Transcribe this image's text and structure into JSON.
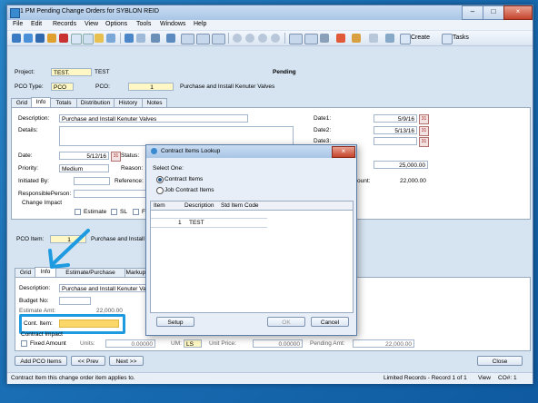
{
  "window": {
    "title": "1 PM Pending Change Orders for SYBLON REID",
    "min": "–",
    "max": "□",
    "close": "×"
  },
  "menu": [
    "File",
    "Edit",
    "Records",
    "View",
    "Options",
    "Tools",
    "Windows",
    "Help"
  ],
  "toolbar": {
    "create_label": "Create",
    "tasks_label": "Tasks"
  },
  "header": {
    "project_label": "Project:",
    "project_value": "TEST.",
    "project_name": "TEST",
    "status": "Pending",
    "pco_type_label": "PCO Type:",
    "pco_type_value": "PCO",
    "pco_label": "PCO:",
    "pco_value": "1",
    "pco_desc": "Purchase and Install Kenuter Valves"
  },
  "top_tabs": [
    "Grid",
    "Info",
    "Totals",
    "Distribution",
    "History",
    "Notes"
  ],
  "info": {
    "description_label": "Description:",
    "description_value": "Purchase and Install Kenuter Valves",
    "details_label": "Details:",
    "date_label": "Date:",
    "date_value": "5/12/16",
    "status_label": "Status:",
    "priority_label": "Priority:",
    "priority_value": "Medium",
    "reason_label": "Reason:",
    "initiated_label": "Initiated By:",
    "reference_label": "Reference:",
    "responsible_label": "ResponsiblePerson:",
    "change_impact_label": "Change Impact",
    "estimate_label": "Estimate",
    "sl_label": "SL",
    "fl_label": "F",
    "date1_label": "Date1:",
    "date1_value": "5/9/16",
    "date2_label": "Date2:",
    "date2_value": "5/13/16",
    "date3_label": "Date3:",
    "amount_value": "25,000.00",
    "ount_label": "ount:",
    "amount2_value": "22,000.00"
  },
  "item": {
    "label": "PCO Item:",
    "value": "1",
    "desc": "Purchase and Install K"
  },
  "bottom_tabs": [
    "Grid",
    "Info",
    "Estimate/Purchase Details",
    "Markups"
  ],
  "item_info": {
    "description_label": "Description:",
    "description_value": "Purchase and Install Kenuter Valves",
    "budget_label": "Budget No:",
    "estimate_label": "Estimate Amt:",
    "estimate_value": "22,000.00",
    "cont_item_label": "Cont. Item:",
    "contract_impact_label": "Contract Impact",
    "fixed_amount_label": "Fixed Amount",
    "units_label": "Units:",
    "units_value": "0.00000",
    "um_label": "UM:",
    "um_value": "LS",
    "unit_price_label": "Unit Price:",
    "unit_price_value": "0.00000",
    "pending_label": "Pending Amt:",
    "pending_value": "22,000.00"
  },
  "footer_buttons": {
    "add": "Add PCO Items",
    "prev": "<< Prev",
    "next": "Next >>",
    "close": "Close"
  },
  "status": {
    "hint": "Contract Item this change order item applies to.",
    "records": "Limited Records - Record 1 of 1",
    "view": "View",
    "co": "CO#: 1"
  },
  "dialog": {
    "title": "Contract Items Lookup",
    "select_one": "Select One:",
    "option1": "Contract Items",
    "option2": "Job Contract Items",
    "columns": [
      "Item",
      "Description",
      "Std Item Code"
    ],
    "rows": [
      {
        "item": "1",
        "description": "TEST",
        "code": ""
      }
    ],
    "setup": "Setup",
    "ok": "OK",
    "cancel": "Cancel"
  }
}
